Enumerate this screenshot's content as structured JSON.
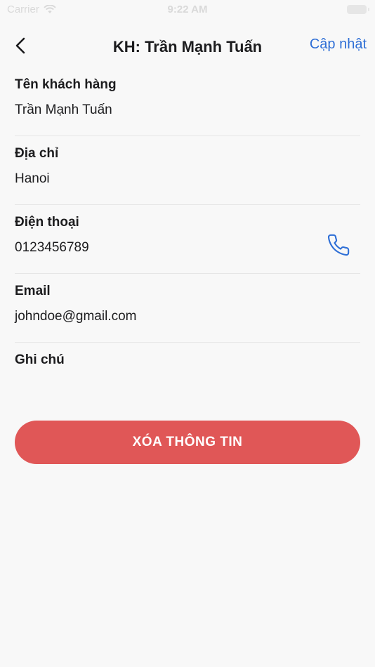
{
  "status_bar": {
    "carrier": "Carrier",
    "time": "9:22 AM"
  },
  "header": {
    "title": "KH: Trần Mạnh Tuấn",
    "update_label": "Cập nhật"
  },
  "fields": [
    {
      "label": "Tên khách hàng",
      "value": "Trần Mạnh Tuấn"
    },
    {
      "label": "Địa chỉ",
      "value": "Hanoi"
    },
    {
      "label": "Điện thoại",
      "value": "0123456789",
      "icon": "phone-icon"
    },
    {
      "label": "Email",
      "value": "johndoe@gmail.com"
    },
    {
      "label": "Ghi chú",
      "value": ""
    }
  ],
  "actions": {
    "delete_label": "XÓA THÔNG TIN"
  },
  "colors": {
    "accent": "#2f6fd6",
    "danger": "#e05757",
    "background": "#f8f8f8"
  }
}
